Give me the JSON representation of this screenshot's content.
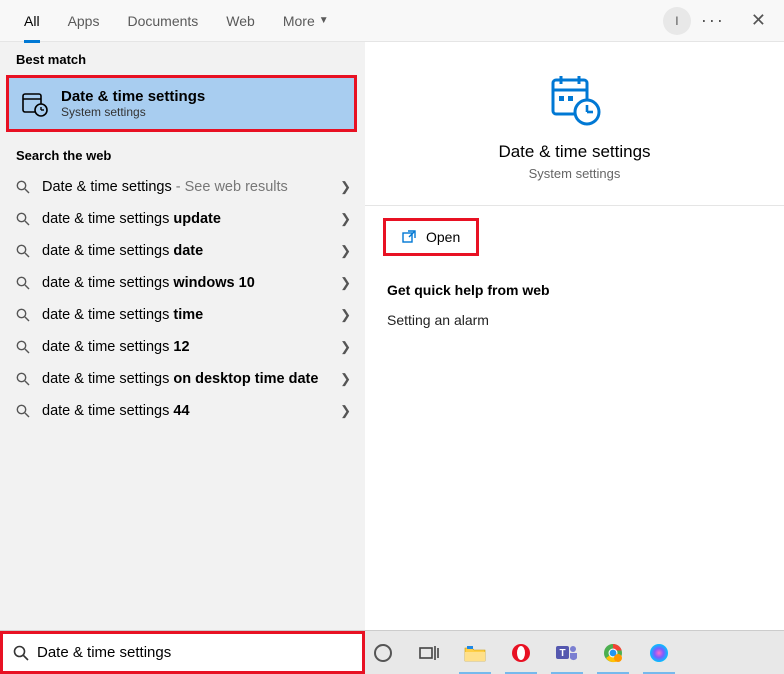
{
  "tabs": {
    "all": "All",
    "apps": "Apps",
    "documents": "Documents",
    "web": "Web",
    "more": "More"
  },
  "account_initial": "I",
  "best_match_label": "Best match",
  "best_match": {
    "title": "Date & time settings",
    "subtitle": "System settings"
  },
  "search_web_label": "Search the web",
  "web_results": [
    {
      "prefix": "Date & time settings",
      "bold": "",
      "hint": " - See web results"
    },
    {
      "prefix": "date & time settings ",
      "bold": "update",
      "hint": ""
    },
    {
      "prefix": "date & time settings ",
      "bold": "date",
      "hint": ""
    },
    {
      "prefix": "date & time settings ",
      "bold": "windows 10",
      "hint": ""
    },
    {
      "prefix": "date & time settings ",
      "bold": "time",
      "hint": ""
    },
    {
      "prefix": "date & time settings ",
      "bold": "12",
      "hint": ""
    },
    {
      "prefix": "date & time settings ",
      "bold": "on desktop time date",
      "hint": ""
    },
    {
      "prefix": "date & time settings ",
      "bold": "44",
      "hint": ""
    }
  ],
  "detail": {
    "title": "Date & time settings",
    "subtitle": "System settings",
    "open": "Open",
    "help_heading": "Get quick help from web",
    "help_link": "Setting an alarm"
  },
  "search": {
    "value": "Date & time settings"
  },
  "colors": {
    "accent": "#0078d4",
    "highlight_border": "#e81123",
    "selection_bg": "#a8cdf0"
  }
}
